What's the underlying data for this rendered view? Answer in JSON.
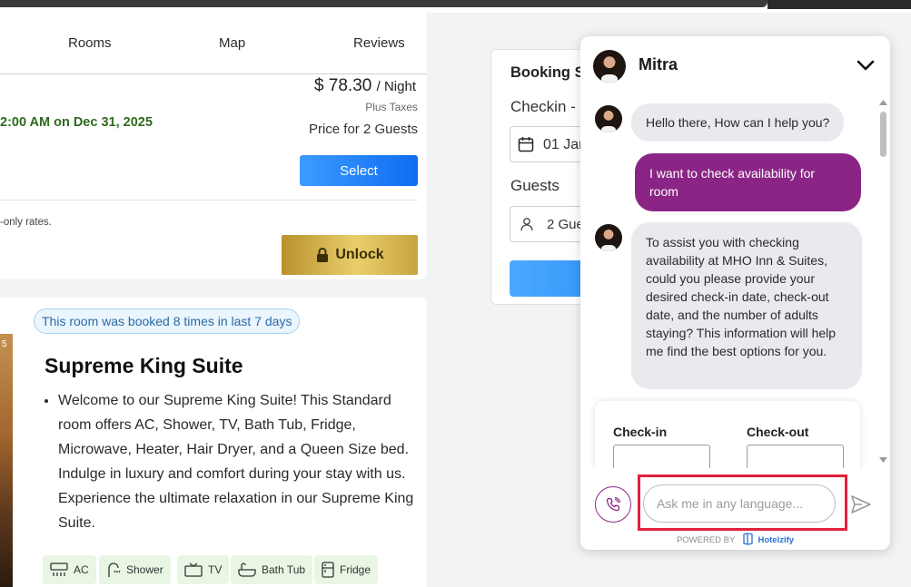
{
  "tabs": [
    {
      "label": "Rooms"
    },
    {
      "label": "Map"
    },
    {
      "label": "Reviews"
    }
  ],
  "rate": {
    "price": "$ 78.30",
    "per": "/ Night",
    "plus_taxes": "Plus Taxes",
    "guests": "Price for 2 Guests",
    "deadline": "2:00 AM on Dec 31, 2025",
    "select_label": "Select",
    "rates_note": "-only rates.",
    "unlock_label": "Unlock"
  },
  "room": {
    "booked_badge": "This room was booked 8 times in last 7 days",
    "title": "Supreme King Suite",
    "description": "Welcome to our Supreme King Suite! This Standard room offers AC, Shower, TV, Bath Tub, Fridge, Microwave, Heater, Hair Dryer, and a Queen Size bed. Indulge in luxury and comfort during your stay with us. Experience the ultimate relaxation in our Supreme King Suite.",
    "image_corner_text": "5",
    "amenities": [
      {
        "label": "AC",
        "icon": "ac-icon"
      },
      {
        "label": "Shower",
        "icon": "shower-icon"
      },
      {
        "label": "TV",
        "icon": "tv-icon"
      },
      {
        "label": "Bath Tub",
        "icon": "bathtub-icon"
      },
      {
        "label": "Fridge",
        "icon": "fridge-icon"
      }
    ]
  },
  "booking": {
    "title": "Booking S",
    "checkin_label": "Checkin - (",
    "date_value": "01 Jan",
    "guests_label": "Guests",
    "guests_value": "2 Gue"
  },
  "chat": {
    "agent_name": "Mitra",
    "messages": [
      {
        "from": "bot",
        "text": "Hello there, How can I help you?"
      },
      {
        "from": "user",
        "text": "I want to check availability for room"
      },
      {
        "from": "bot",
        "text": "To assist you with checking availability at MHO Inn & Suites, could you please provide your desired check-in date, check-out date, and the number of adults staying? This information will help me find the best options for you."
      }
    ],
    "form": {
      "checkin_label": "Check-in",
      "checkout_label": "Check-out"
    },
    "input_placeholder": "Ask me in any language...",
    "powered_by": "POWERED BY",
    "brand": "Hotelzify",
    "colors": {
      "user_bubble": "#8a2585",
      "bot_bubble": "#e9e9ee",
      "highlight": "#e0213a"
    }
  }
}
